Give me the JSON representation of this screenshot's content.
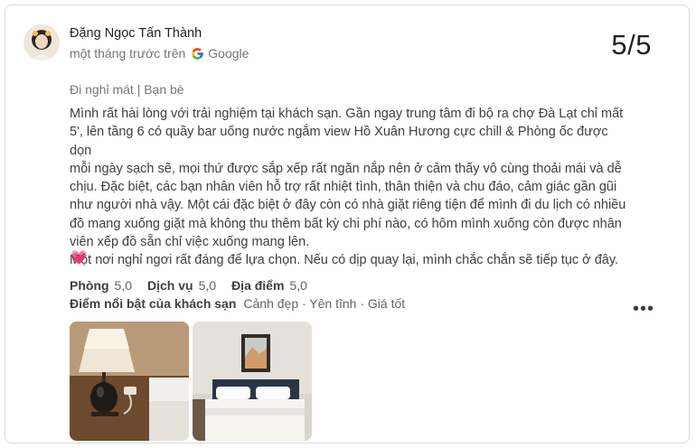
{
  "review": {
    "reviewer_name": "Đặng Ngọc Tấn Thành",
    "time_ago": "một tháng trước trên",
    "source": "Google",
    "score": "5/5",
    "trip_type": "Đi nghỉ mát | Bạn bè",
    "text": "Mình rất hài lòng với trải nghiệm tại khách sạn. Gần ngay trung tâm đi bộ ra chợ Đà Lạt chỉ mất\n5', lên tầng 6 có quầy bar uống nước ngắm view Hồ Xuân Hương cực chill & Phòng ốc được dọn\nmỗi ngày sạch sẽ, mọi thứ được sắp xếp rất ngăn nắp nên ở cảm thấy vô cùng thoải mái và dễ\nchịu. Đặc biệt, các bạn nhân viên hỗ trợ rất nhiệt tình, thân thiện và chu đáo, cảm giác gần gũi\nnhư người nhà vậy. Một cái đặc biệt ở đây còn có nhà giặt riêng tiện để mình đi du lịch có nhiều\nđồ mang xuống giặt mà không thu thêm bất kỳ chi phí nào, có hôm mình xuống còn được nhân\nviên xếp đồ sẵn chỉ việc xuống mang lên.\nMột nơi nghỉ ngơi rất đáng để lựa chọn. Nếu có dịp quay lại, mình chắc chắn sẽ tiếp tục ở đây.",
    "emoji": "💗",
    "ratings": [
      {
        "label": "Phòng",
        "value": "5,0"
      },
      {
        "label": "Dịch vụ",
        "value": "5,0"
      },
      {
        "label": "Địa điểm",
        "value": "5,0"
      }
    ],
    "highlights_label": "Điểm nổi bật của khách sạn",
    "highlights_value": "Cảnh đẹp · Yên tĩnh · Giá tốt",
    "more_label": "•••",
    "photos": [
      {
        "icon": "lamp-bedside-photo"
      },
      {
        "icon": "bedroom-photo"
      }
    ]
  }
}
